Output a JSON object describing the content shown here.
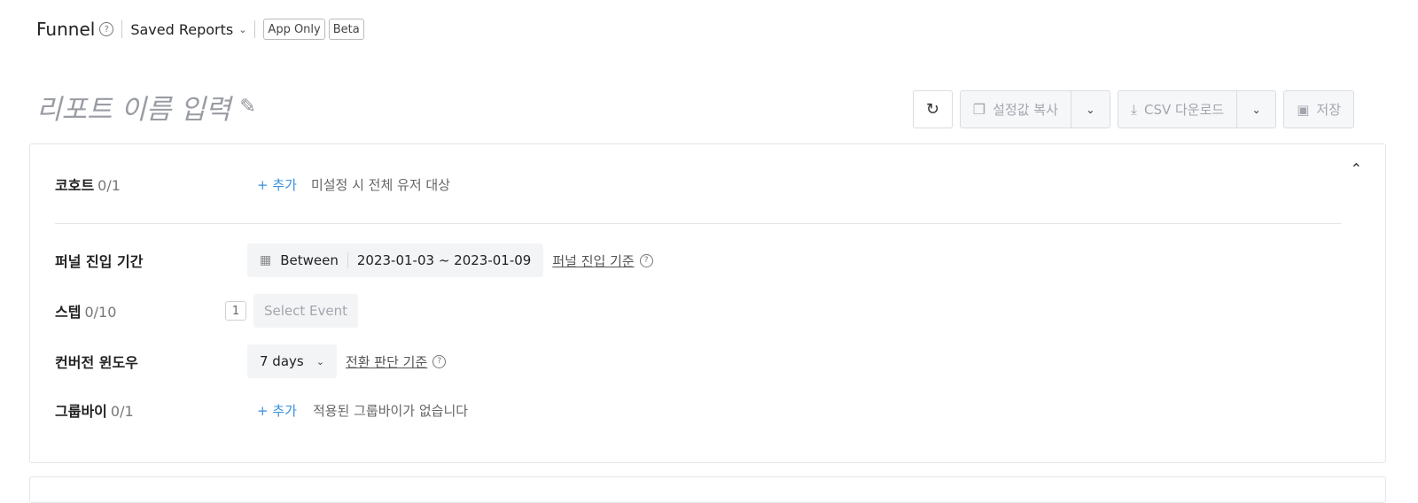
{
  "header": {
    "title": "Funnel",
    "saved_reports": "Saved Reports",
    "tags": [
      "App Only",
      "Beta"
    ]
  },
  "report": {
    "name_placeholder": "리포트 이름 입력"
  },
  "toolbar": {
    "copy_settings": "설정값 복사",
    "csv_download": "CSV 다운로드",
    "save": "저장"
  },
  "panel": {
    "cohort": {
      "label": "코호트",
      "count": "0/1",
      "add": "+ 추가",
      "hint": "미설정 시 전체 유저 대상"
    },
    "funnel_period": {
      "label": "퍼널 진입 기간",
      "mode": "Between",
      "range": "2023-01-03 ~ 2023-01-09",
      "criteria_link": "퍼널 진입 기준"
    },
    "steps": {
      "label": "스텝",
      "count": "0/10",
      "step_number": "1",
      "select_event": "Select Event"
    },
    "conversion_window": {
      "label": "컨버전 윈도우",
      "value": "7 days",
      "criteria_link": "전환 판단 기준"
    },
    "group_by": {
      "label": "그룹바이",
      "count": "0/1",
      "add": "+ 추가",
      "hint": "적용된 그룹바이가 없습니다"
    }
  },
  "icons": {
    "help": "question-circle-icon",
    "pencil": "pencil-icon",
    "refresh": "refresh-icon",
    "copy": "copy-icon",
    "download": "download-icon",
    "save": "floppy-icon",
    "calendar": "calendar-icon",
    "collapse": "chevron-up-icon"
  },
  "colors": {
    "link_blue": "#3a8fde",
    "muted_text": "#a4a6ad",
    "border": "#e4e5e8"
  }
}
